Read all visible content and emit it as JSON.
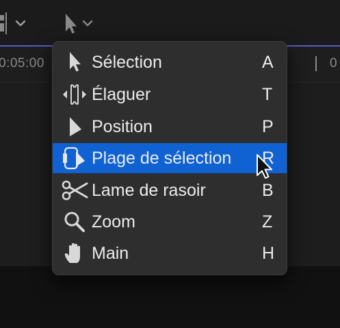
{
  "toolbar": {
    "left_icon": "layout-icon",
    "tool_icon": "arrow-pointer-icon",
    "chevron_icon": "chevron-down-icon"
  },
  "timeline": {
    "timecode_left": "0:05:00",
    "timecode_right": "0"
  },
  "menu": {
    "items": [
      {
        "label": "Sélection",
        "shortcut": "A",
        "icon": "arrow-pointer-icon"
      },
      {
        "label": "Élaguer",
        "shortcut": "T",
        "icon": "trim-icon"
      },
      {
        "label": "Position",
        "shortcut": "P",
        "icon": "position-icon"
      },
      {
        "label": "Plage de sélection",
        "shortcut": "R",
        "icon": "range-selection-icon"
      },
      {
        "label": "Lame de rasoir",
        "shortcut": "B",
        "icon": "blade-icon"
      },
      {
        "label": "Zoom",
        "shortcut": "Z",
        "icon": "zoom-icon"
      },
      {
        "label": "Main",
        "shortcut": "H",
        "icon": "hand-icon"
      }
    ],
    "selected_index": 3
  },
  "colors": {
    "accent": "#1062d3",
    "menu_bg": "#2e2e2e",
    "timeline_line": "#5a5ad0"
  }
}
